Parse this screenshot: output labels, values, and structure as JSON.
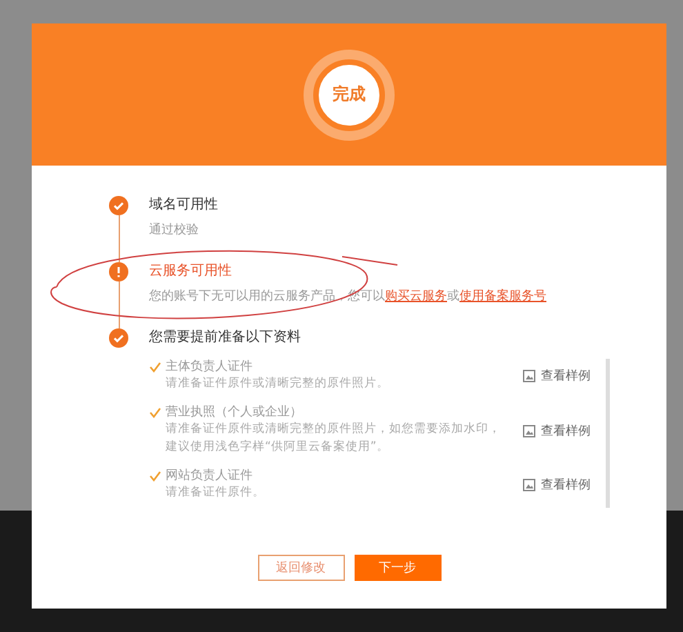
{
  "header": {
    "badge": "完成"
  },
  "steps": [
    {
      "kind": "done",
      "title": "域名可用性",
      "description": [
        {
          "kind": "text",
          "text": "通过校验"
        }
      ]
    },
    {
      "kind": "warning",
      "title": "云服务可用性",
      "description": [
        {
          "kind": "text",
          "text": "您的账号下无可以用的云服务产品，您可以"
        },
        {
          "kind": "link",
          "text": "购买云服务"
        },
        {
          "kind": "text",
          "text": "或"
        },
        {
          "kind": "link",
          "text": "使用备案服务号"
        }
      ]
    },
    {
      "kind": "done",
      "title": "您需要提前准备以下资料"
    }
  ],
  "materials": [
    {
      "title": "主体负责人证件",
      "description": "请准备证件原件或清晰完整的原件照片。",
      "action": "查看样例"
    },
    {
      "title": "营业执照（个人或企业）",
      "description": "请准备证件原件或清晰完整的原件照片，如您需要添加水印，建议使用浅色字样“供阿里云备案使用”。",
      "action": "查看样例"
    },
    {
      "title": "网站负责人证件",
      "description": "请准备证件原件。",
      "action": "查看样例"
    }
  ],
  "buttons": [
    {
      "kind": "secondary",
      "label": "返回修改"
    },
    {
      "kind": "primary",
      "label": "下一步"
    }
  ]
}
